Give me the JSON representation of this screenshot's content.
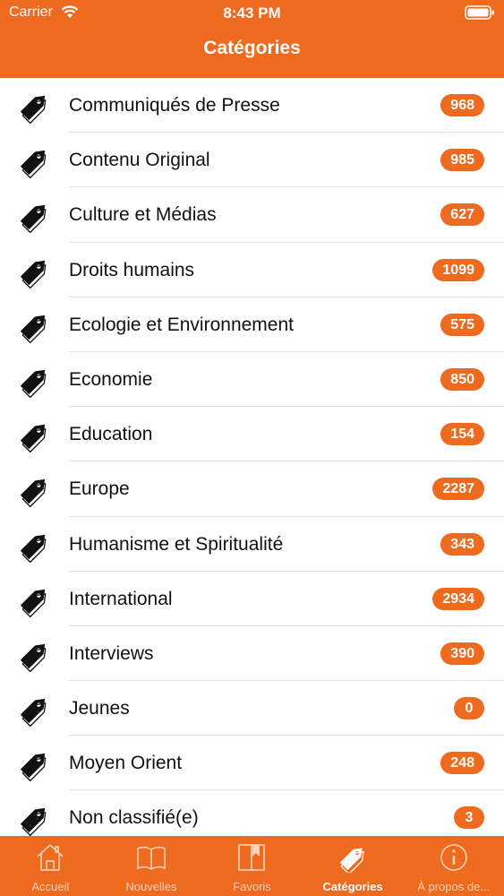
{
  "status_bar": {
    "carrier": "Carrier",
    "time": "8:43 PM"
  },
  "nav": {
    "title": "Catégories"
  },
  "colors": {
    "accent": "#ee6a1e",
    "tab_inactive": "#fbd3bb",
    "text": "#111111"
  },
  "categories": [
    {
      "label": "Communiqués de Presse",
      "count": "968"
    },
    {
      "label": "Contenu Original",
      "count": "985"
    },
    {
      "label": "Culture et Médias",
      "count": "627"
    },
    {
      "label": "Droits humains",
      "count": "1099"
    },
    {
      "label": "Ecologie et Environnement",
      "count": "575"
    },
    {
      "label": "Economie",
      "count": "850"
    },
    {
      "label": "Education",
      "count": "154"
    },
    {
      "label": "Europe",
      "count": "2287"
    },
    {
      "label": "Humanisme et Spiritualité",
      "count": "343"
    },
    {
      "label": "International",
      "count": "2934"
    },
    {
      "label": "Interviews",
      "count": "390"
    },
    {
      "label": "Jeunes",
      "count": "0"
    },
    {
      "label": "Moyen Orient",
      "count": "248"
    },
    {
      "label": "Non classifié(e)",
      "count": "3"
    }
  ],
  "tabbar": {
    "tabs": [
      {
        "label": "Accueil",
        "icon": "home-icon",
        "active": false
      },
      {
        "label": "Nouvelles",
        "icon": "book-icon",
        "active": false
      },
      {
        "label": "Favoris",
        "icon": "bookmark-icon",
        "active": false
      },
      {
        "label": "Catégories",
        "icon": "tag-icon",
        "active": true
      },
      {
        "label": "À propos de...",
        "icon": "info-icon",
        "active": false
      }
    ]
  }
}
